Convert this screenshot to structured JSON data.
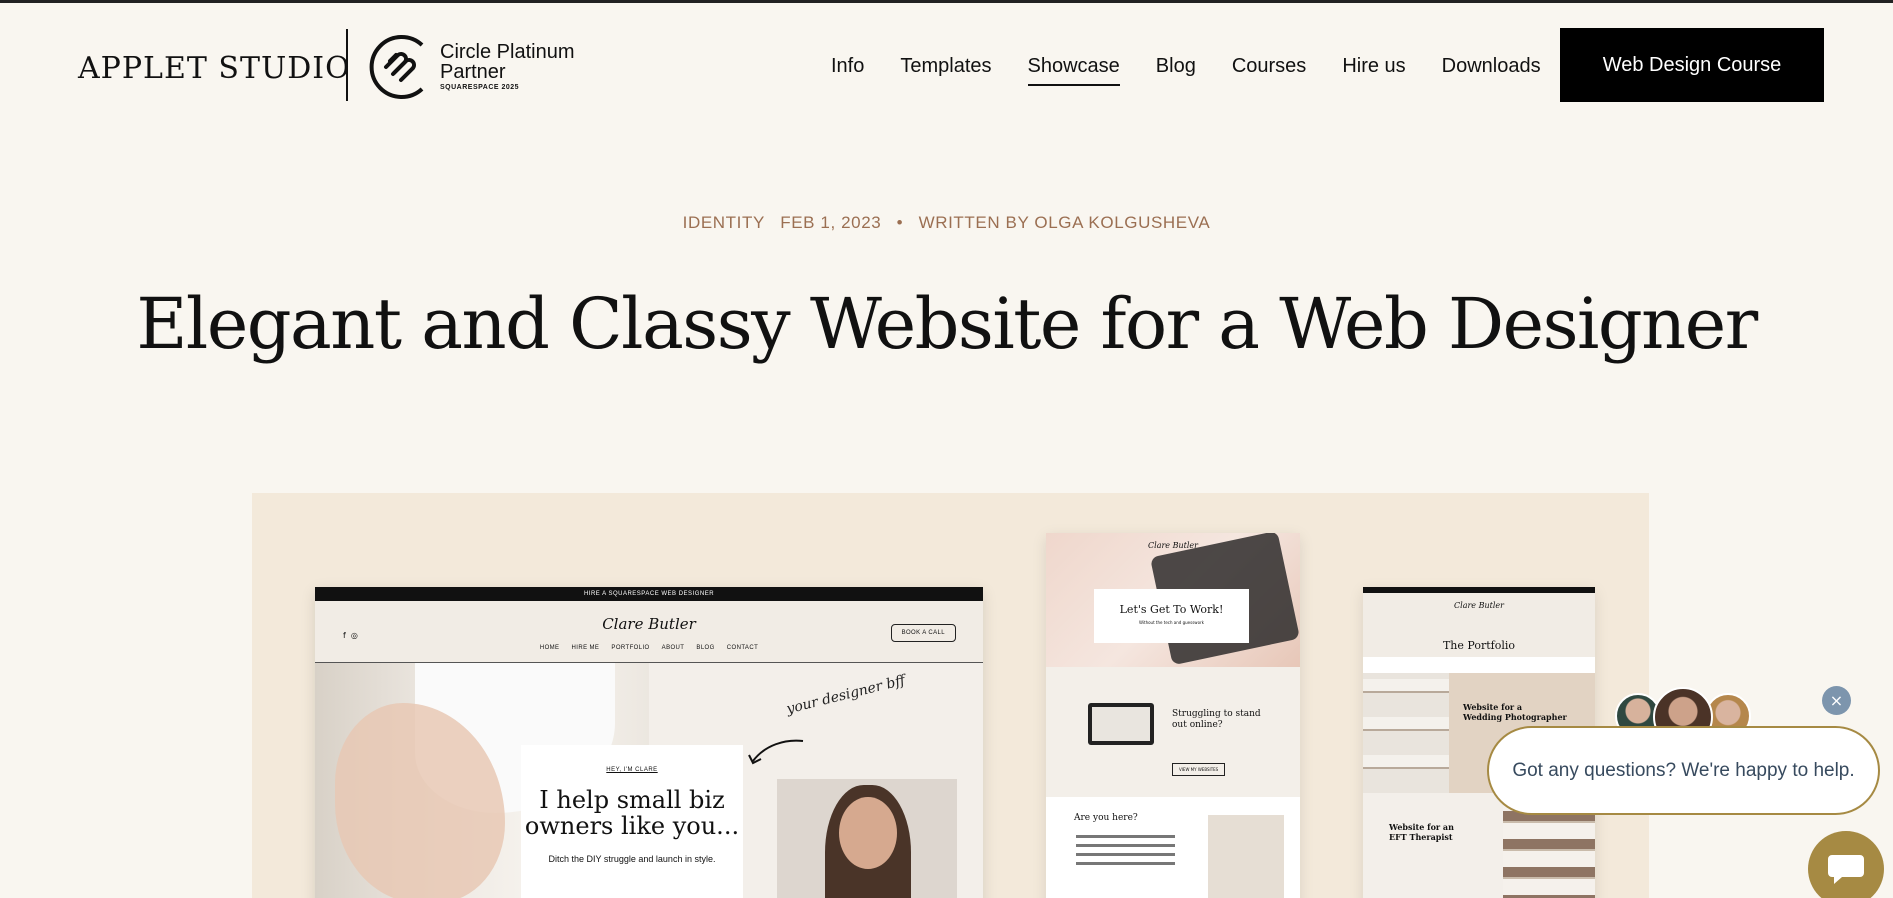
{
  "header": {
    "logo": "APPLET STUDIO",
    "partner": {
      "line1": "Circle Platinum",
      "line2": "Partner",
      "line3": "SQUARESPACE 2025"
    },
    "nav": [
      "Info",
      "Templates",
      "Showcase",
      "Blog",
      "Courses",
      "Hire us",
      "Downloads"
    ],
    "active_nav": "Showcase",
    "cta": "Web Design Course"
  },
  "post": {
    "category": "IDENTITY",
    "date": "FEB 1, 2023",
    "separator": "•",
    "author": "WRITTEN BY OLGA KOLGUSHEVA",
    "title": "Elegant and Classy Website for a Web Designer"
  },
  "hero": {
    "mock1": {
      "topbar": "HIRE A SQUARESPACE WEB DESIGNER",
      "brand": "Clare Butler",
      "nav": [
        "HOME",
        "HIRE ME",
        "PORTFOLIO",
        "ABOUT",
        "BLOG",
        "CONTACT"
      ],
      "book": "BOOK A CALL",
      "signature": "your designer bff",
      "hey": "HEY, I'M CLARE",
      "headline_1": "I help small biz",
      "headline_2": "owners like you...",
      "sub": "Ditch the DIY struggle and launch in style."
    },
    "mock2": {
      "brand": "Clare Butler",
      "card_title": "Let's Get To Work!",
      "card_sub": "Without the tech and guesswork",
      "mid_title_1": "Struggling to stand",
      "mid_title_2": "out online?",
      "mid_button": "VIEW MY WEBSITES",
      "bottom_title": "Are you here?"
    },
    "mock3": {
      "brand": "Clare Butler",
      "title": "The Portfolio",
      "card1_1": "Website for a",
      "card1_2": "Wedding Photographer",
      "card2_1": "Website for an",
      "card2_2": "EFT Therapist"
    }
  },
  "chat": {
    "close": "×",
    "message": "Got any questions? We're happy to help."
  },
  "colors": {
    "background": "#f9f6f0",
    "meta": "#9b6f52",
    "hero_bg": "#f3e9da",
    "chat_accent": "#a68a43",
    "close_btn": "#7d95ad"
  }
}
